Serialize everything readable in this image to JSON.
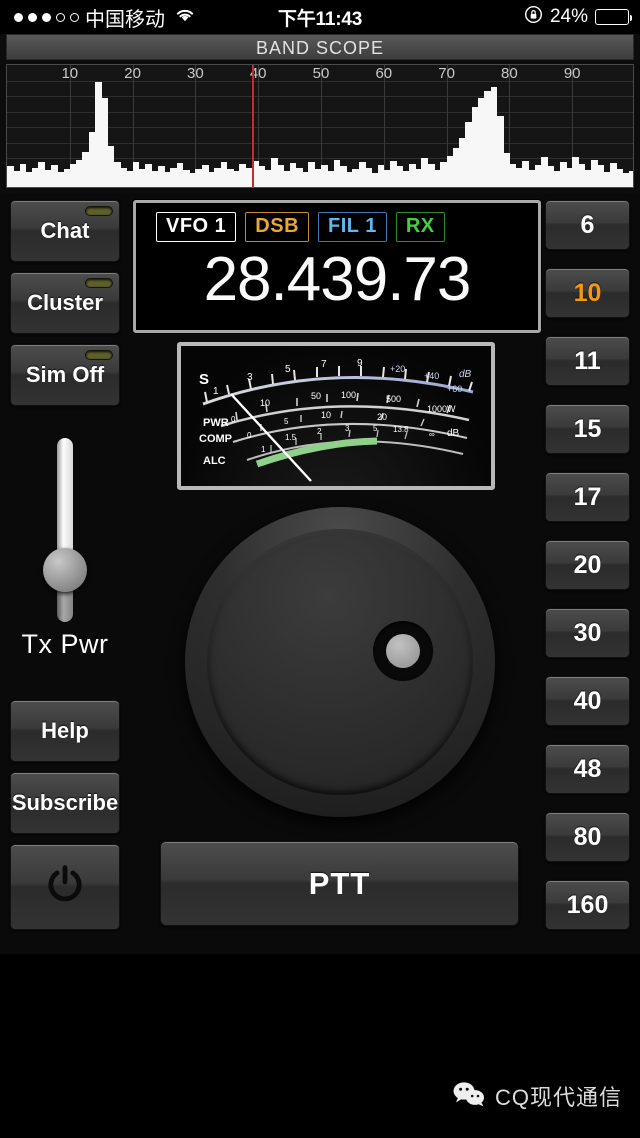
{
  "statusbar": {
    "signal_dots_filled": 3,
    "signal_dots_total": 5,
    "carrier": "中国移动",
    "wifi_icon": "wifi-icon",
    "time": "下午11:43",
    "rotation_lock_icon": "rotation-lock-icon",
    "battery_percent_label": "24%",
    "battery_level": 24
  },
  "scope": {
    "title": "BAND SCOPE",
    "marker_position": 39
  },
  "chart_data": {
    "type": "area",
    "title": "BAND SCOPE",
    "xlabel": "",
    "ylabel": "",
    "xlim": [
      0,
      100
    ],
    "ylim": [
      0,
      100
    ],
    "grid": true,
    "tick_labels": [
      "10",
      "20",
      "30",
      "40",
      "50",
      "60",
      "70",
      "80",
      "90"
    ],
    "tick_values": [
      10,
      20,
      30,
      40,
      50,
      60,
      70,
      80,
      90
    ],
    "marker_x": 39,
    "marker_color": "#c52b2b",
    "trace_color": "#f7f7f7",
    "peaks": [
      {
        "x": 14.5,
        "y": 92
      },
      {
        "x": 77,
        "y": 88
      }
    ],
    "x": [
      0,
      1,
      2,
      3,
      4,
      5,
      6,
      7,
      8,
      9,
      10,
      11,
      12,
      13,
      14,
      15,
      16,
      17,
      18,
      19,
      20,
      21,
      22,
      23,
      24,
      25,
      26,
      27,
      28,
      29,
      30,
      31,
      32,
      33,
      34,
      35,
      36,
      37,
      38,
      39,
      40,
      41,
      42,
      43,
      44,
      45,
      46,
      47,
      48,
      49,
      50,
      51,
      52,
      53,
      54,
      55,
      56,
      57,
      58,
      59,
      60,
      61,
      62,
      63,
      64,
      65,
      66,
      67,
      68,
      69,
      70,
      71,
      72,
      73,
      74,
      75,
      76,
      77,
      78,
      79,
      80,
      81,
      82,
      83,
      84,
      85,
      86,
      87,
      88,
      89,
      90,
      91,
      92,
      93,
      94,
      95,
      96,
      97,
      98,
      99
    ],
    "values": [
      18,
      14,
      20,
      13,
      17,
      22,
      15,
      19,
      13,
      16,
      20,
      24,
      31,
      48,
      92,
      78,
      36,
      22,
      17,
      14,
      22,
      16,
      20,
      14,
      18,
      13,
      17,
      21,
      15,
      12,
      16,
      19,
      13,
      17,
      22,
      16,
      14,
      20,
      17,
      23,
      18,
      15,
      25,
      19,
      14,
      21,
      17,
      13,
      22,
      16,
      19,
      14,
      24,
      18,
      13,
      16,
      22,
      17,
      12,
      19,
      15,
      23,
      18,
      14,
      20,
      16,
      25,
      20,
      15,
      22,
      27,
      34,
      43,
      57,
      70,
      78,
      84,
      88,
      62,
      30,
      20,
      17,
      23,
      15,
      19,
      26,
      18,
      14,
      22,
      17,
      26,
      20,
      15,
      24,
      19,
      13,
      21,
      16,
      12,
      14
    ]
  },
  "left_buttons": [
    {
      "label": "Chat",
      "name": "chat-button",
      "led": true
    },
    {
      "label": "Cluster",
      "name": "cluster-button",
      "led": true
    },
    {
      "label": "Sim Off",
      "name": "sim-off-button",
      "led": true
    }
  ],
  "slider": {
    "label": "Tx Pwr",
    "value_fraction": 0.62
  },
  "left_buttons_bottom": [
    {
      "label": "Help",
      "name": "help-button"
    },
    {
      "label": "Subscribe",
      "name": "subscribe-button"
    }
  ],
  "power_button": {
    "icon": "power-icon",
    "label": ""
  },
  "vfo": {
    "badges": [
      {
        "label": "VFO 1",
        "color": "#ffffff",
        "border": "#ffffff"
      },
      {
        "label": "DSB",
        "color": "#e8a83c",
        "border": "#c48a23"
      },
      {
        "label": "FIL 1",
        "color": "#63b6ee",
        "border": "#3d79b8"
      },
      {
        "label": "RX",
        "color": "#43d13f",
        "border": "#2e8c2c"
      }
    ],
    "frequency": "28.439.73"
  },
  "smeter": {
    "name": "s-meter",
    "scale_s_label": "S",
    "scale_s_ticks": [
      "1",
      "3",
      "5",
      "7",
      "9",
      "+20",
      "+40",
      "+60"
    ],
    "scale_s_unit": "dB",
    "pwr_label": "PWR",
    "pwr_ticks": [
      "0",
      "10",
      "50",
      "100",
      "500",
      "1000W"
    ],
    "comp_label": "COMP",
    "comp_ticks": [
      "0",
      "5",
      "10",
      "20"
    ],
    "comp_unit": "dB",
    "alc_label": "ALC",
    "alc_ticks": [
      "1",
      "1.5",
      "2",
      "3",
      "5",
      "13.8",
      "∞"
    ],
    "alc_bar_color": "#8fd08a",
    "needle_color": "#ffffff"
  },
  "tuning_knob": {
    "name": "tuning-knob",
    "indicator_angle_deg": 40
  },
  "ptt": {
    "label": "PTT"
  },
  "bands": [
    {
      "label": "6",
      "active": false
    },
    {
      "label": "10",
      "active": true
    },
    {
      "label": "11",
      "active": false
    },
    {
      "label": "15",
      "active": false
    },
    {
      "label": "17",
      "active": false
    },
    {
      "label": "20",
      "active": false
    },
    {
      "label": "30",
      "active": false
    },
    {
      "label": "40",
      "active": false
    },
    {
      "label": "48",
      "active": false
    },
    {
      "label": "80",
      "active": false
    },
    {
      "label": "160",
      "active": false
    }
  ],
  "footer": {
    "watermark_icon": "wechat-icon",
    "watermark_text": "CQ现代通信"
  },
  "colors": {
    "accent_orange": "#f29a16",
    "led_olive": "#5e5f2a",
    "marker_red": "#c52b2b"
  }
}
